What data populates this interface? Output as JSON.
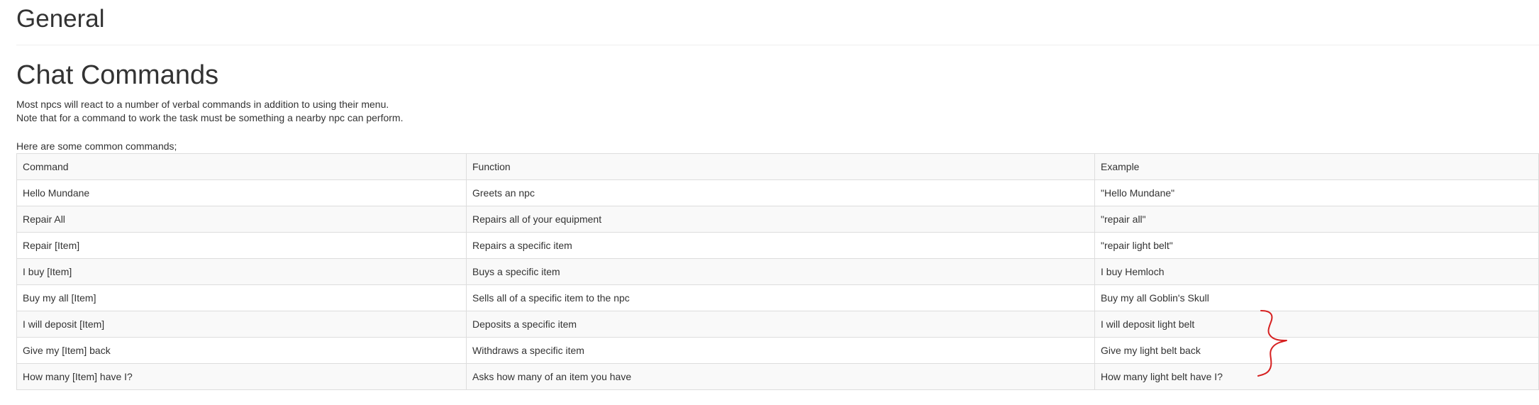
{
  "page": {
    "heading_general": "General",
    "heading_chat": "Chat Commands",
    "intro_line1": "Most npcs will react to a number of verbal commands in addition to using their menu.",
    "intro_line2": "Note that for a command to work the task must be something a nearby npc can perform.",
    "intro_line3": "Here are some common commands;"
  },
  "table": {
    "headers": [
      "Command",
      "Function",
      "Example"
    ],
    "rows": [
      [
        "Hello Mundane",
        "Greets an npc",
        "\"Hello Mundane\""
      ],
      [
        "Repair All",
        "Repairs all of your equipment",
        "\"repair all\""
      ],
      [
        "Repair [Item]",
        "Repairs a specific item",
        "\"repair light belt\""
      ],
      [
        "I buy [Item]",
        "Buys a specific item",
        "I buy Hemloch"
      ],
      [
        "Buy my all [Item]",
        "Sells all of a specific item to the npc",
        "Buy my all Goblin's Skull"
      ],
      [
        "I will deposit [Item]",
        "Deposits a specific item",
        "I will deposit light belt"
      ],
      [
        "Give my [Item] back",
        "Withdraws a specific item",
        "Give my light belt back"
      ],
      [
        "How many [Item] have I?",
        "Asks how many of an item you have",
        "How many light belt have I?"
      ]
    ]
  },
  "colors": {
    "text": "#333333",
    "border": "#dddddd",
    "stripe": "#f9f9f9",
    "annotation": "#d62020"
  },
  "annotation": {
    "icon": "curly-brace-annotation"
  }
}
